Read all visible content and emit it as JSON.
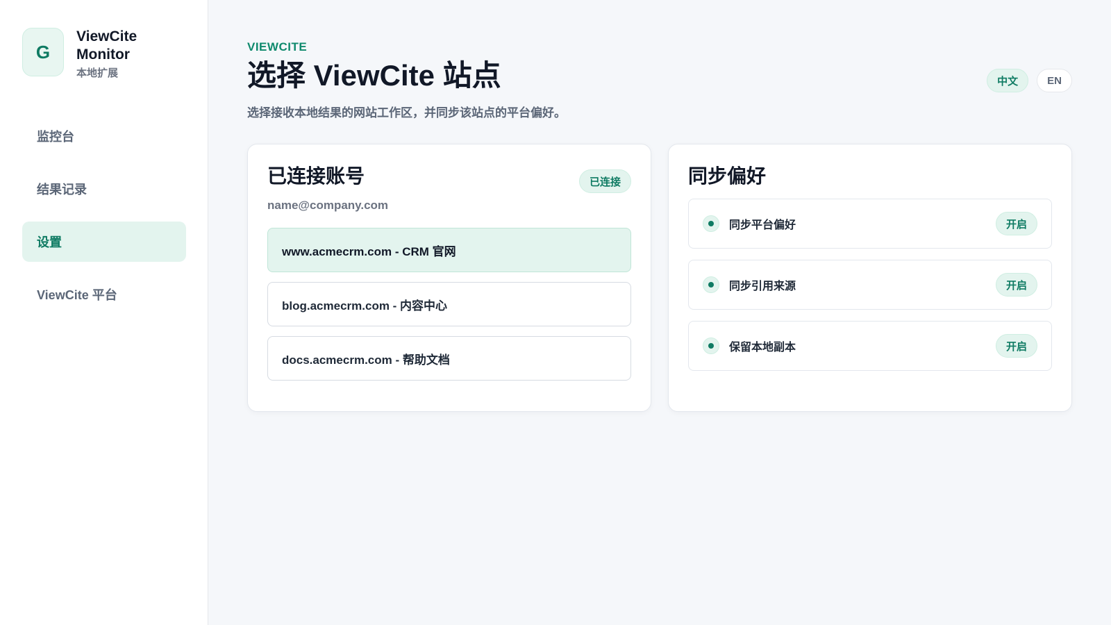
{
  "brand": {
    "logo_letter": "G",
    "name": "ViewCite Monitor",
    "subtitle": "本地扩展"
  },
  "sidebar": {
    "items": [
      {
        "label": "监控台",
        "active": false
      },
      {
        "label": "结果记录",
        "active": false
      },
      {
        "label": "设置",
        "active": true
      },
      {
        "label": "ViewCite 平台",
        "active": false
      }
    ]
  },
  "header": {
    "eyebrow": "VIEWCITE",
    "title": "选择 ViewCite 站点",
    "description": "选择接收本地结果的网站工作区，并同步该站点的平台偏好。",
    "languages": [
      {
        "label": "中文",
        "active": true
      },
      {
        "label": "EN",
        "active": false
      }
    ]
  },
  "account_card": {
    "title": "已连接账号",
    "status_badge": "已连接",
    "email": "name@company.com",
    "sites": [
      {
        "label": "www.acmecrm.com - CRM 官网",
        "selected": true
      },
      {
        "label": "blog.acmecrm.com - 内容中心",
        "selected": false
      },
      {
        "label": "docs.acmecrm.com - 帮助文档",
        "selected": false
      }
    ]
  },
  "prefs_card": {
    "title": "同步偏好",
    "items": [
      {
        "label": "同步平台偏好",
        "toggle": "开启"
      },
      {
        "label": "同步引用来源",
        "toggle": "开启"
      },
      {
        "label": "保留本地副本",
        "toggle": "开启"
      }
    ]
  },
  "colors": {
    "accent": "#0f7b63",
    "accent_bg": "#e3f4ee",
    "background": "#f5f7fa"
  }
}
